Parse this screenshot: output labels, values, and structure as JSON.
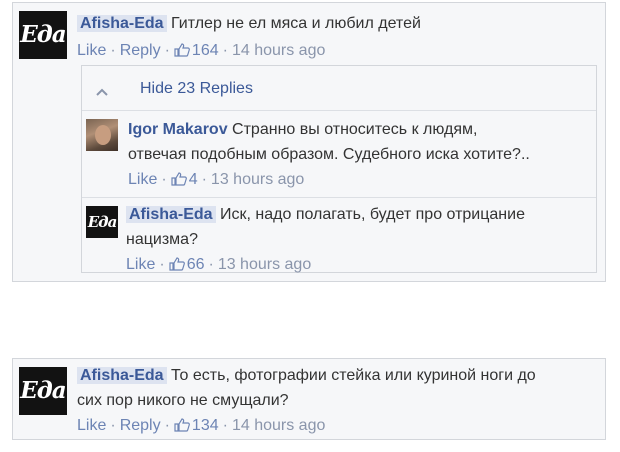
{
  "comments": [
    {
      "avatar_text": "Еда",
      "author": "Afisha-Eda",
      "text_lines": [
        "Гитлер не ел мяса и любил детей"
      ],
      "like_label": "Like",
      "reply_label": "Reply",
      "likes": "164",
      "time": "14 hours ago",
      "replies_toggle": "Hide 23 Replies",
      "replies": [
        {
          "author": "Igor Makarov",
          "text_lines": [
            "Странно вы относитесь к людям,",
            "отвечая подобным образом. Судебного иска хотите?.."
          ],
          "like_label": "Like",
          "likes": "4",
          "time": "13 hours ago"
        },
        {
          "avatar_text": "Еда",
          "author": "Afisha-Eda",
          "text_lines": [
            "Иск, надо полагать, будет про отрицание",
            "нацизма?"
          ],
          "like_label": "Like",
          "likes": "66",
          "time": "13 hours ago"
        }
      ]
    },
    {
      "avatar_text": "Еда",
      "author": "Afisha-Eda",
      "text_lines": [
        "То есть, фотографии стейка или куриной ноги до",
        "сих пор никого не смущали?"
      ],
      "like_label": "Like",
      "reply_label": "Reply",
      "likes": "134",
      "time": "14 hours ago"
    }
  ],
  "colors": {
    "link": "#3b5998",
    "meta": "#8a95ab",
    "card_bg": "#f6f7f9",
    "border": "#d3d6db",
    "author_highlight": "#dde3f0"
  }
}
